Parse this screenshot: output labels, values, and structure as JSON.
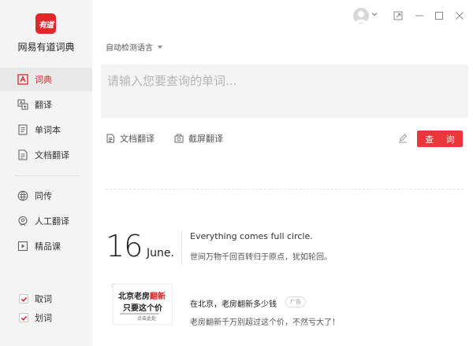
{
  "app": {
    "logo_text": "有道",
    "name": "网易有道词典"
  },
  "sidebar": {
    "items": [
      {
        "label": "词典",
        "icon": "dictionary-icon",
        "active": true
      },
      {
        "label": "翻译",
        "icon": "translate-icon"
      },
      {
        "label": "单词本",
        "icon": "wordbook-icon"
      },
      {
        "label": "文档翻译",
        "icon": "document-translate-icon"
      },
      {
        "label": "同传",
        "icon": "simultaneous-interpretation-icon"
      },
      {
        "label": "人工翻译",
        "icon": "human-translation-icon"
      },
      {
        "label": "精品课",
        "icon": "course-icon"
      }
    ],
    "checks": [
      {
        "label": "取词",
        "checked": true
      },
      {
        "label": "划词",
        "checked": true
      }
    ]
  },
  "header": {
    "lang_select": "自动检测语言"
  },
  "search": {
    "placeholder": "请输入您要查询的单词..."
  },
  "tools": {
    "doc_translate": "文档翻译",
    "screenshot_translate": "截屏翻译",
    "query_button": "查 询"
  },
  "daily": {
    "day": "16",
    "month": "June.",
    "quote_en": "Everything comes full circle.",
    "quote_cn": "世间万物千回百转归于原点，犹如轮回。"
  },
  "ad": {
    "image_line1_black": "北京老房",
    "image_line1_red": "翻新",
    "image_line2": "只要这个价",
    "image_line3": "点击此处",
    "title": "在北京，老房翻新多少钱",
    "badge": "广告",
    "subtitle": "老房翻新千万别超过这个价，不然亏大了！"
  },
  "colors": {
    "accent": "#e0282b",
    "sidebar_bg": "#f4f4f4",
    "search_bg": "#f4f4f4"
  }
}
